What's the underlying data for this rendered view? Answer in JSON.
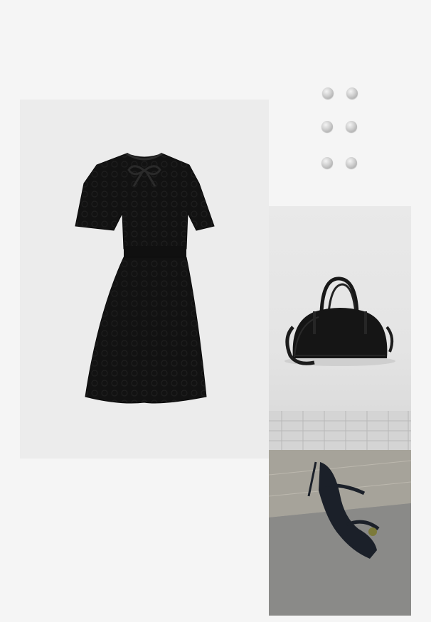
{
  "collage": {
    "products": [
      {
        "name": "black-knit-bow-dress"
      },
      {
        "name": "silver-stud-earrings"
      },
      {
        "name": "black-leather-handbag"
      },
      {
        "name": "black-toe-ring-sandal"
      }
    ]
  },
  "colors": {
    "page_background": "#f5f5f5",
    "dress_background": "#ececec",
    "dress": "#121212",
    "bag": "#151515",
    "sandal": "#1b2029",
    "stud": "#c9c9c9"
  }
}
